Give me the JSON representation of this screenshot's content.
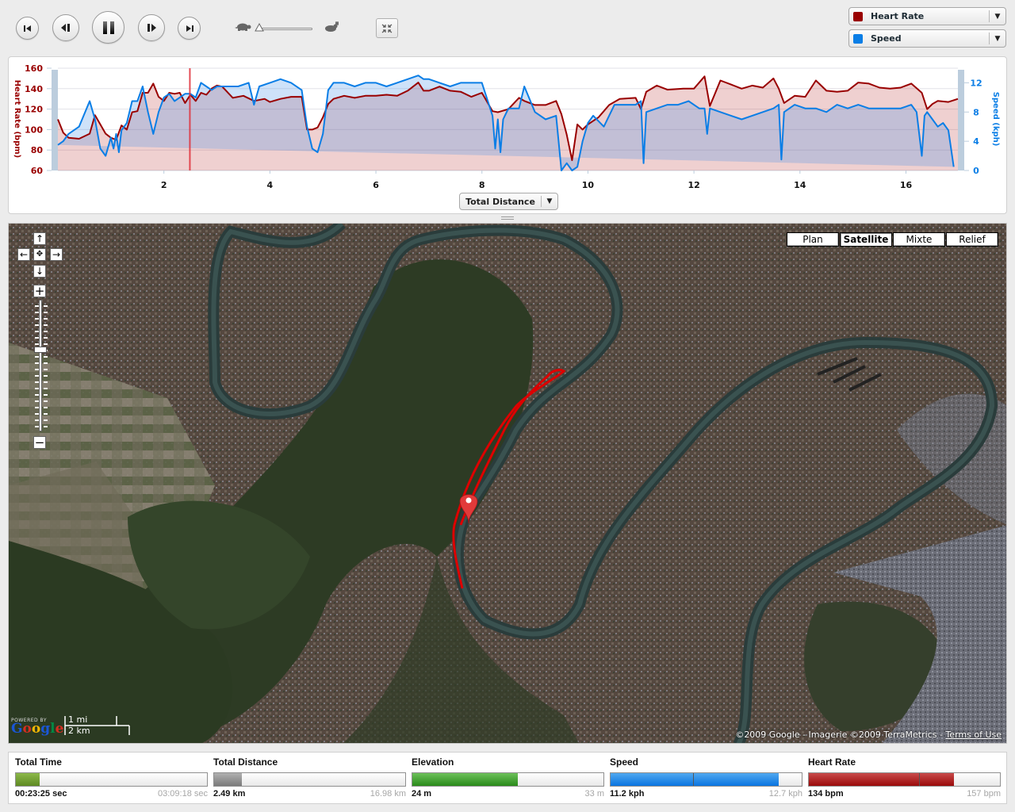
{
  "toolbar": {
    "buttons": [
      {
        "name": "skip-to-start",
        "icon": "skip-start-icon"
      },
      {
        "name": "step-back",
        "icon": "step-back-icon"
      },
      {
        "name": "pause",
        "icon": "pause-icon"
      },
      {
        "name": "step-forward",
        "icon": "step-forward-icon"
      },
      {
        "name": "skip-to-end",
        "icon": "skip-end-icon"
      }
    ],
    "playback_speed": {
      "min_icon": "turtle-icon",
      "max_icon": "rabbit-icon",
      "value_fraction": 0.0
    },
    "fullscreen_icon": "collapse-icon",
    "series_selectors": [
      {
        "label": "Heart Rate",
        "color": "#990000"
      },
      {
        "label": "Speed",
        "color": "#0a7ee6"
      }
    ]
  },
  "chart": {
    "x_axis_selector": "Total Distance"
  },
  "chart_data": {
    "type": "area",
    "title": "",
    "xlabel": "Total Distance",
    "x_ticks": [
      2,
      4,
      6,
      8,
      10,
      12,
      14,
      16
    ],
    "xlim": [
      0,
      16.98
    ],
    "cursor_x": 2.49,
    "grid": true,
    "legend": "top-right",
    "y_left": {
      "label": "Heart Rate (bpm)",
      "ticks": [
        60,
        80,
        100,
        120,
        140,
        160
      ],
      "ylim": [
        60,
        160
      ],
      "color": "#990000"
    },
    "y_right": {
      "label": "Speed (kph)",
      "ticks": [
        0,
        4,
        8,
        12
      ],
      "ylim": [
        0,
        14
      ],
      "color": "#0a7ee6"
    },
    "series": [
      {
        "name": "Heart Rate",
        "axis": "left",
        "color": "#990000",
        "x": [
          0.0,
          0.1,
          0.2,
          0.4,
          0.6,
          0.7,
          0.8,
          0.9,
          1.0,
          1.1,
          1.2,
          1.3,
          1.4,
          1.5,
          1.6,
          1.7,
          1.8,
          1.9,
          2.0,
          2.1,
          2.2,
          2.3,
          2.4,
          2.5,
          2.6,
          2.7,
          2.8,
          2.9,
          3.0,
          3.1,
          3.3,
          3.5,
          3.7,
          3.9,
          4.0,
          4.2,
          4.4,
          4.6,
          4.7,
          4.8,
          4.9,
          5.0,
          5.1,
          5.2,
          5.4,
          5.6,
          5.8,
          6.0,
          6.2,
          6.4,
          6.6,
          6.8,
          6.9,
          7.0,
          7.2,
          7.4,
          7.6,
          7.8,
          8.0,
          8.2,
          8.3,
          8.5,
          8.7,
          8.8,
          9.0,
          9.2,
          9.4,
          9.5,
          9.6,
          9.7,
          9.8,
          9.9,
          10.0,
          10.2,
          10.4,
          10.6,
          10.9,
          11.0,
          11.1,
          11.3,
          11.5,
          11.8,
          12.0,
          12.2,
          12.3,
          12.5,
          12.7,
          12.9,
          13.1,
          13.3,
          13.5,
          13.6,
          13.7,
          13.9,
          14.1,
          14.3,
          14.5,
          14.7,
          14.9,
          15.1,
          15.3,
          15.5,
          15.7,
          15.9,
          16.1,
          16.3,
          16.4,
          16.5,
          16.6,
          16.8,
          16.98
        ],
        "values": [
          110,
          97,
          92,
          91,
          96,
          114,
          105,
          96,
          92,
          90,
          104,
          100,
          117,
          118,
          136,
          136,
          145,
          132,
          128,
          136,
          135,
          136,
          126,
          134,
          128,
          136,
          134,
          140,
          143,
          142,
          131,
          133,
          128,
          130,
          127,
          130,
          132,
          132,
          100,
          100,
          102,
          112,
          125,
          130,
          133,
          131,
          133,
          133,
          134,
          133,
          138,
          146,
          138,
          138,
          142,
          138,
          137,
          132,
          136,
          118,
          117,
          120,
          131,
          128,
          124,
          124,
          128,
          115,
          95,
          70,
          105,
          100,
          105,
          112,
          124,
          130,
          131,
          120,
          137,
          143,
          139,
          140,
          140,
          152,
          123,
          148,
          144,
          140,
          143,
          141,
          150,
          140,
          126,
          133,
          132,
          148,
          138,
          137,
          138,
          146,
          145,
          141,
          140,
          141,
          145,
          136,
          120,
          125,
          128,
          127,
          130
        ]
      },
      {
        "name": "Speed",
        "axis": "right",
        "color": "#0a7ee6",
        "x": [
          0.0,
          0.1,
          0.2,
          0.4,
          0.6,
          0.7,
          0.8,
          0.9,
          1.0,
          1.05,
          1.1,
          1.15,
          1.2,
          1.3,
          1.4,
          1.5,
          1.6,
          1.7,
          1.8,
          1.9,
          2.0,
          2.1,
          2.2,
          2.3,
          2.4,
          2.5,
          2.6,
          2.7,
          2.8,
          2.9,
          3.0,
          3.2,
          3.4,
          3.6,
          3.7,
          3.8,
          4.0,
          4.2,
          4.4,
          4.6,
          4.7,
          4.8,
          4.9,
          5.0,
          5.1,
          5.2,
          5.4,
          5.6,
          5.8,
          6.0,
          6.2,
          6.4,
          6.6,
          6.8,
          6.9,
          7.0,
          7.2,
          7.4,
          7.6,
          7.8,
          8.0,
          8.2,
          8.25,
          8.3,
          8.35,
          8.4,
          8.5,
          8.7,
          8.8,
          9.0,
          9.2,
          9.4,
          9.5,
          9.6,
          9.7,
          9.8,
          9.9,
          10.0,
          10.1,
          10.3,
          10.5,
          10.7,
          10.9,
          11.0,
          11.05,
          11.1,
          11.3,
          11.5,
          11.7,
          11.9,
          12.1,
          12.2,
          12.25,
          12.3,
          12.5,
          12.7,
          12.9,
          13.1,
          13.3,
          13.5,
          13.6,
          13.65,
          13.7,
          13.9,
          14.1,
          14.3,
          14.5,
          14.7,
          14.9,
          15.1,
          15.3,
          15.5,
          15.7,
          15.9,
          16.1,
          16.2,
          16.3,
          16.35,
          16.4,
          16.5,
          16.6,
          16.7,
          16.8,
          16.9,
          16.98
        ],
        "values": [
          3.5,
          4,
          5,
          6,
          9.5,
          7,
          3,
          2,
          4.5,
          3,
          5,
          2.5,
          5.5,
          6.5,
          9.5,
          9.5,
          11.5,
          8,
          5,
          8,
          10,
          10.5,
          9.5,
          10,
          10.5,
          10.5,
          10,
          12,
          11.5,
          11,
          11.5,
          11.5,
          11.5,
          12,
          9,
          11.5,
          12,
          12.5,
          12,
          11,
          6,
          3,
          2.5,
          5,
          11,
          12,
          12,
          11.5,
          12,
          12,
          11.5,
          12,
          12.5,
          13,
          12.5,
          12.5,
          12,
          11.5,
          12,
          12,
          12,
          7.5,
          3,
          7,
          2.5,
          7,
          8.5,
          8.5,
          11.5,
          8,
          7,
          7.5,
          0,
          1,
          0,
          0.5,
          4,
          6.5,
          7.5,
          6,
          9,
          9,
          9,
          9.5,
          1,
          8,
          8.5,
          9,
          9,
          9.5,
          8.5,
          8.5,
          5,
          8.5,
          8,
          7.5,
          7,
          7.5,
          8,
          8.5,
          9,
          1.5,
          8,
          9,
          8.5,
          8.5,
          8,
          9,
          8.5,
          9,
          8.5,
          8.5,
          8.5,
          8.5,
          9,
          8,
          2,
          7.5,
          8,
          7,
          6,
          6.5,
          5.5,
          0.5
        ]
      }
    ]
  },
  "map": {
    "nav": {
      "up": "↑",
      "left": "←",
      "center": "✥",
      "right": "→",
      "down": "↓",
      "zoom_in": "+",
      "zoom_out": "−"
    },
    "zoom_level_fraction": 0.35,
    "map_types": [
      {
        "label": "Plan",
        "active": false
      },
      {
        "label": "Satellite",
        "active": true
      },
      {
        "label": "Mixte",
        "active": false
      },
      {
        "label": "Relief",
        "active": false
      }
    ],
    "attribution": "©2009 Google - Imagerie ©2009 TerraMetrics - ",
    "terms_label": "Terms of Use",
    "powered_by": "POWERED BY",
    "google_logo": [
      "G",
      "o",
      "o",
      "g",
      "l",
      "e"
    ],
    "google_colors": [
      "#1a56d6",
      "#d62d20",
      "#f2b705",
      "#1a56d6",
      "#008744",
      "#d62d20"
    ],
    "scale_mi": "1 mi",
    "scale_km": "2 km",
    "route_color": "#dd0000",
    "marker_color": "#e23a3a"
  },
  "stats": [
    {
      "title": "Total Time",
      "current": "00:23:25 sec",
      "max": "03:09:18 sec",
      "fraction": 0.124,
      "fill_colors": [
        "#8cb84a",
        "#5e8a22"
      ],
      "marker": null
    },
    {
      "title": "Total Distance",
      "current": "2.49 km",
      "max": "16.98 km",
      "fraction": 0.147,
      "fill_colors": [
        "#b0b0b0",
        "#7a7a7a"
      ],
      "marker": null
    },
    {
      "title": "Elevation",
      "current": "24 m",
      "max": "33 m",
      "fraction": 0.55,
      "fill_colors": [
        "#6cc05a",
        "#2a8a1a"
      ],
      "marker": null
    },
    {
      "title": "Speed",
      "current": "11.2 kph",
      "max": "12.7 kph",
      "fraction": 0.88,
      "fill_colors": [
        "#50a8f0",
        "#0a74e0"
      ],
      "marker": 0.43
    },
    {
      "title": "Heart Rate",
      "current": "134 bpm",
      "max": "157 bpm",
      "fraction": 0.76,
      "fill_colors": [
        "#c84a4a",
        "#9a0a0a"
      ],
      "marker": 0.575
    }
  ]
}
